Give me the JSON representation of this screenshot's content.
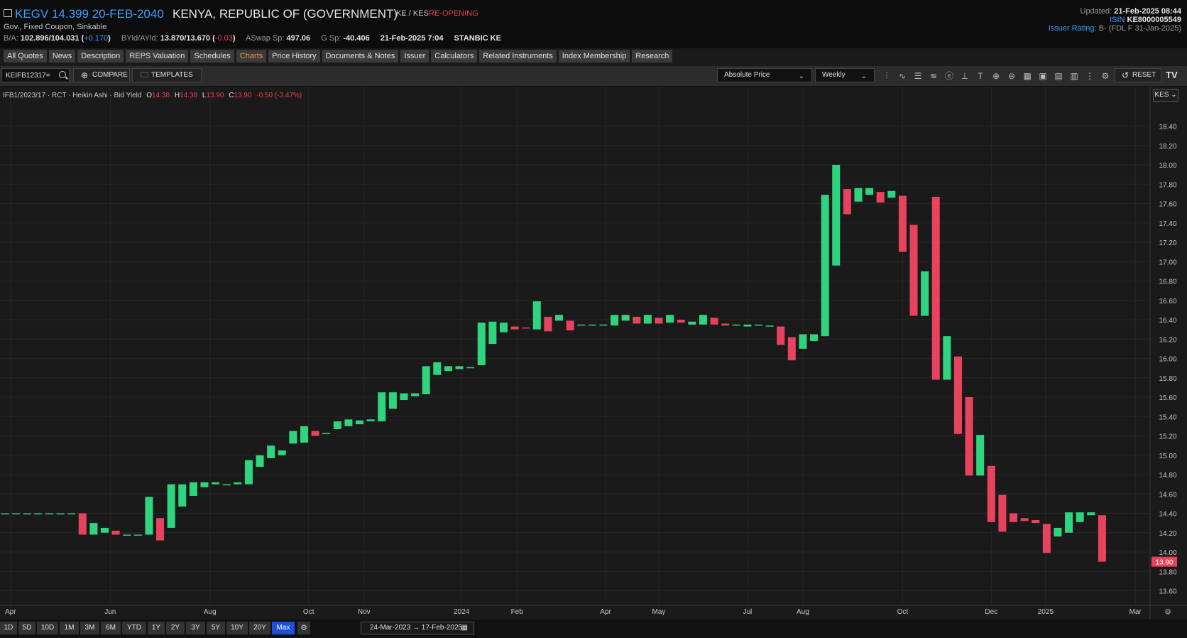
{
  "header": {
    "ric": "KEGV 14.399 20-FEB-2040",
    "issuer": "KENYA, REPUBLIC OF (GOVERNMENT)",
    "currency": "KE / KES",
    "status": "RE-OPENING",
    "subtitle": "Gov., Fixed Coupon, Sinkable",
    "quotes": {
      "ba_label": "B/A:",
      "ba_value": "102.896/104.031",
      "ba_change": "(+0.170)",
      "byld_label": "BYld/AYld:",
      "byld_value": "13.870/13.670",
      "byld_change": "(-0.03)",
      "aswap_label": "ASwap Sp:",
      "aswap_value": "497.06",
      "gsp_label": "G Sp:",
      "gsp_value": "-40.406",
      "timestamp": "21-Feb-2025 7:04",
      "source": "STANBIC KE"
    },
    "updated_label": "Updated:",
    "updated_value": "21-Feb-2025 08:44",
    "isin_label": "ISIN",
    "isin_value": "KE8000005549",
    "rating_label": "Issuer Rating:",
    "rating_value": "B- (FDL F 31-Jan-2025)"
  },
  "tabs": [
    "All Quotes",
    "News",
    "Description",
    "REPS Valuation",
    "Schedules",
    "Charts",
    "Price History",
    "Documents & Notes",
    "Issuer",
    "Calculators",
    "Related Instruments",
    "Index Membership",
    "Research"
  ],
  "active_tab": "Charts",
  "toolbar": {
    "search_value": "KEIFB12317=",
    "compare_label": "COMPARE",
    "templates_label": "TEMPLATES",
    "price_type": "Absolute Price",
    "interval": "Weekly",
    "reset_label": "RESET",
    "logo": "TV",
    "icons": [
      "candles-icon",
      "indicators-icon",
      "table-icon",
      "waves-icon",
      "events-icon",
      "crosshair-icon",
      "text-icon",
      "zoom-in-icon",
      "zoom-out-icon",
      "grid-icon",
      "layout-icon",
      "save-icon",
      "bar-chart-icon",
      "more-icon",
      "settings-icon"
    ]
  },
  "legend": {
    "symbol": "IFB1/2023/17 · RCT · Heikin Ashi · Bid Yield",
    "o_label": "O",
    "o_value": "14.38",
    "h_label": "H",
    "h_value": "14.38",
    "l_label": "L",
    "l_value": "13.90",
    "c_label": "C",
    "c_value": "13.90",
    "change": "-0.50 (-3.47%)"
  },
  "currency_button": "KES",
  "periods": [
    "1D",
    "5D",
    "10D",
    "1M",
    "3M",
    "6M",
    "YTD",
    "1Y",
    "2Y",
    "3Y",
    "5Y",
    "10Y",
    "20Y",
    "Max"
  ],
  "active_period": "Max",
  "date_range": "24-Mar-2023 → 17-Feb-2025",
  "colors": {
    "up": "#2fd47f",
    "down": "#e8435e",
    "accent": "#3aa0ff",
    "active_tab": "#f0913a",
    "active_period": "#1f4fd8"
  },
  "chart_data": {
    "type": "candlestick",
    "subtype": "Heikin Ashi",
    "ylabel": "Bid Yield",
    "ylim": [
      13.5,
      18.6
    ],
    "y_ticks": [
      "18.40",
      "18.20",
      "18.00",
      "17.80",
      "17.60",
      "17.40",
      "17.20",
      "17.00",
      "16.80",
      "16.60",
      "16.40",
      "16.20",
      "16.00",
      "15.80",
      "15.60",
      "15.40",
      "15.20",
      "15.00",
      "14.80",
      "14.60",
      "14.40",
      "14.20",
      "14.00",
      "13.80",
      "13.60"
    ],
    "x_ticks": [
      {
        "label": "Apr",
        "week": 0.5
      },
      {
        "label": "Jun",
        "week": 9.5
      },
      {
        "label": "Aug",
        "week": 18.5
      },
      {
        "label": "Oct",
        "week": 27.4
      },
      {
        "label": "Nov",
        "week": 32.4
      },
      {
        "label": "2024",
        "week": 41.2
      },
      {
        "label": "Feb",
        "week": 46.2
      },
      {
        "label": "Apr",
        "week": 54.2
      },
      {
        "label": "May",
        "week": 59.0
      },
      {
        "label": "Jul",
        "week": 67.0
      },
      {
        "label": "Aug",
        "week": 72.0
      },
      {
        "label": "Oct",
        "week": 81.0
      },
      {
        "label": "Dec",
        "week": 89.0
      },
      {
        "label": "2025",
        "week": 93.9
      },
      {
        "label": "Mar",
        "week": 102.0
      }
    ],
    "last_value": "13.90",
    "candles": [
      [
        0,
        14.4,
        14.4
      ],
      [
        1,
        14.4,
        14.4
      ],
      [
        2,
        14.4,
        14.4
      ],
      [
        3,
        14.4,
        14.4
      ],
      [
        4,
        14.4,
        14.4
      ],
      [
        5,
        14.4,
        14.4
      ],
      [
        6,
        14.4,
        14.4
      ],
      [
        7,
        14.4,
        14.18
      ],
      [
        8,
        14.18,
        14.3
      ],
      [
        9,
        14.2,
        14.25
      ],
      [
        10,
        14.22,
        14.18
      ],
      [
        11,
        14.18,
        14.18
      ],
      [
        12,
        14.17,
        14.18
      ],
      [
        13,
        14.18,
        14.57
      ],
      [
        14,
        14.35,
        14.12
      ],
      [
        15,
        14.25,
        14.7
      ],
      [
        16,
        14.47,
        14.7
      ],
      [
        17,
        14.58,
        14.72
      ],
      [
        18,
        14.67,
        14.72
      ],
      [
        19,
        14.7,
        14.72
      ],
      [
        20,
        14.7,
        14.7
      ],
      [
        21,
        14.7,
        14.72
      ],
      [
        22,
        14.7,
        14.95
      ],
      [
        23,
        14.88,
        15.0
      ],
      [
        24,
        14.97,
        15.1
      ],
      [
        25,
        15.0,
        15.05
      ],
      [
        26,
        15.12,
        15.25
      ],
      [
        27,
        15.13,
        15.3
      ],
      [
        28,
        15.25,
        15.2
      ],
      [
        29,
        15.22,
        15.23
      ],
      [
        30,
        15.27,
        15.35
      ],
      [
        31,
        15.3,
        15.37
      ],
      [
        32,
        15.32,
        15.36
      ],
      [
        33,
        15.35,
        15.37
      ],
      [
        34,
        15.35,
        15.65
      ],
      [
        35,
        15.48,
        15.65
      ],
      [
        36,
        15.57,
        15.64
      ],
      [
        37,
        15.61,
        15.64
      ],
      [
        38,
        15.63,
        15.92
      ],
      [
        39,
        15.83,
        15.96
      ],
      [
        40,
        15.87,
        15.92
      ],
      [
        41,
        15.89,
        15.92
      ],
      [
        42,
        15.9,
        15.91
      ],
      [
        43,
        15.93,
        16.37
      ],
      [
        44,
        16.15,
        16.38
      ],
      [
        45,
        16.27,
        16.37
      ],
      [
        46,
        16.33,
        16.3
      ],
      [
        47,
        16.32,
        16.31
      ],
      [
        48,
        16.3,
        16.59
      ],
      [
        49,
        16.43,
        16.28
      ],
      [
        50,
        16.39,
        16.45
      ],
      [
        51,
        16.39,
        16.29
      ],
      [
        52,
        16.34,
        16.35
      ],
      [
        53,
        16.34,
        16.35
      ],
      [
        54,
        16.34,
        16.35
      ],
      [
        55,
        16.34,
        16.45
      ],
      [
        56,
        16.39,
        16.45
      ],
      [
        57,
        16.43,
        16.36
      ],
      [
        58,
        16.36,
        16.45
      ],
      [
        59,
        16.42,
        16.36
      ],
      [
        60,
        16.37,
        16.45
      ],
      [
        61,
        16.4,
        16.37
      ],
      [
        62,
        16.35,
        16.38
      ],
      [
        63,
        16.35,
        16.45
      ],
      [
        64,
        16.42,
        16.35
      ],
      [
        65,
        16.36,
        16.34
      ],
      [
        66,
        16.34,
        16.35
      ],
      [
        67,
        16.33,
        16.35
      ],
      [
        68,
        16.34,
        16.35
      ],
      [
        69,
        16.34,
        16.34
      ],
      [
        70,
        16.33,
        16.14
      ],
      [
        71,
        16.22,
        15.98
      ],
      [
        72,
        16.1,
        16.25
      ],
      [
        73,
        16.18,
        16.25
      ],
      [
        74,
        16.23,
        17.69
      ],
      [
        75,
        16.96,
        18.0
      ],
      [
        76,
        17.75,
        17.49
      ],
      [
        77,
        17.62,
        17.76
      ],
      [
        78,
        17.69,
        17.76
      ],
      [
        79,
        17.72,
        17.61
      ],
      [
        80,
        17.66,
        17.73
      ],
      [
        81,
        17.68,
        17.1
      ],
      [
        82,
        17.38,
        16.44
      ],
      [
        83,
        16.44,
        16.9
      ],
      [
        84,
        17.67,
        15.78
      ],
      [
        85,
        15.78,
        16.23
      ],
      [
        86,
        16.02,
        15.22
      ],
      [
        87,
        15.6,
        14.79
      ],
      [
        88,
        14.79,
        15.21
      ],
      [
        89,
        14.89,
        14.31
      ],
      [
        90,
        14.59,
        14.21
      ],
      [
        91,
        14.4,
        14.31
      ],
      [
        92,
        14.35,
        14.32
      ],
      [
        93,
        14.33,
        14.3
      ],
      [
        94,
        14.29,
        13.99
      ],
      [
        95,
        14.16,
        14.25
      ],
      [
        96,
        14.2,
        14.41
      ],
      [
        97,
        14.31,
        14.41
      ],
      [
        98,
        14.38,
        14.41
      ],
      [
        99,
        14.38,
        13.9
      ]
    ]
  }
}
